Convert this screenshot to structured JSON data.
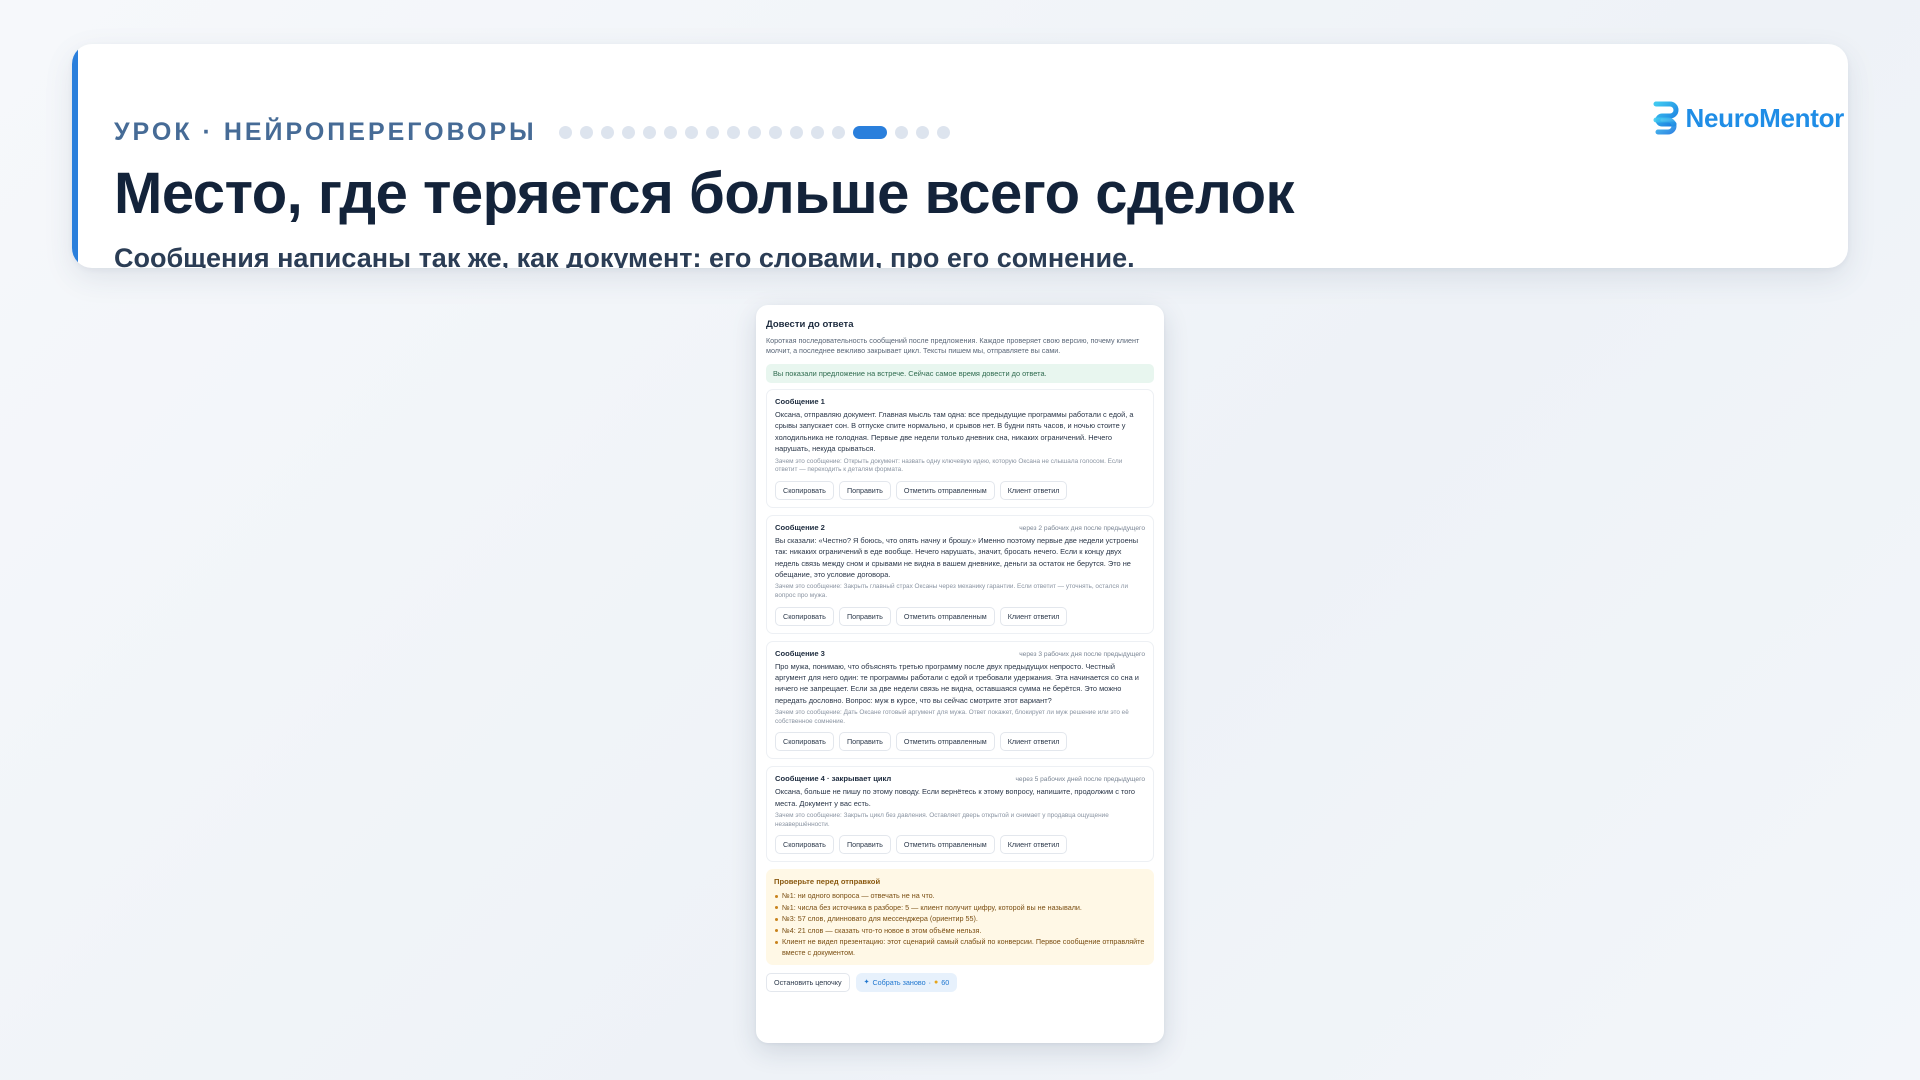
{
  "header": {
    "eyebrow": "УРОК · НЕЙРОПЕРЕГОВОРЫ",
    "progress": {
      "total": 18,
      "current": 15
    },
    "title": "Место, где теряется больше всего сделок",
    "subtitle": "Сообщения написаны так же, как документ: его словами, про его сомнение.",
    "brand": "NeuroMentor",
    "brand_icon": "neuromentor-logo-icon",
    "accent_color": "#2a7fdc"
  },
  "panel": {
    "title": "Довести до ответа",
    "description": "Короткая последовательность сообщений после предложения. Каждое проверяет свою версию, почему клиент молчит, а последнее вежливо закрывает цикл. Тексты пишем мы, отправляете вы сами.",
    "banner": "Вы показали предложение на встрече. Сейчас самое время довести до ответа.",
    "messages": [
      {
        "title": "Сообщение 1",
        "delay": "",
        "body": "Оксана, отправляю документ. Главная мысль там одна: все предыдущие программы работали с едой, а срывы запускает сон. В отпуске спите нормально, и срывов нет. В будни пять часов, и ночью стоите у холодильника не голодная. Первые две недели только дневник сна, никаких ограничений. Нечего нарушать, некуда срываться.",
        "why": "Зачем это сообщение: Открыть документ: назвать одну ключевую идею, которую Оксана не слышала голосом. Если ответит — переходить к деталям формата."
      },
      {
        "title": "Сообщение 2",
        "delay": "через 2 рабочих дня после предыдущего",
        "body": "Вы сказали: «Честно? Я боюсь, что опять начну и брошу.» Именно поэтому первые две недели устроены так: никаких ограничений в еде вообще. Нечего нарушать, значит, бросать нечего. Если к концу двух недель связь между сном и срывами не видна в вашем дневнике, деньги за остаток не берутся. Это не обещание, это условие договора.",
        "why": "Зачем это сообщение: Закрыть главный страх Оксаны через механику гарантии. Если ответит — уточнять, остался ли вопрос про мужа."
      },
      {
        "title": "Сообщение 3",
        "delay": "через 3 рабочих дня после предыдущего",
        "body": "Про мужа, понимаю, что объяснять третью программу после двух предыдущих непросто. Честный аргумент для него один: те программы работали с едой и требовали удержания. Эта начинается со сна и ничего не запрещает. Если за две недели связь не видна, оставшаяся сумма не берётся. Это можно передать дословно. Вопрос: муж в курсе, что вы сейчас смотрите этот вариант?",
        "why": "Зачем это сообщение: Дать Оксане готовый аргумент для мужа. Ответ покажет, блокирует ли муж решение или это её собственное сомнение."
      },
      {
        "title": "Сообщение 4 · закрывает цикл",
        "delay": "через 5 рабочих дней после предыдущего",
        "body": "Оксана, больше не пишу по этому поводу. Если вернётесь к этому вопросу, напишите, продолжим с того места. Документ у вас есть.",
        "why": "Зачем это сообщение: Закрыть цикл без давления. Оставляет дверь открытой и снимает у продавца ощущение незавершённости."
      }
    ],
    "actions": {
      "copy": "Скопировать",
      "edit": "Поправить",
      "mark_sent": "Отметить отправленным",
      "client_replied": "Клиент ответил"
    },
    "checklist": {
      "title": "Проверьте перед отправкой",
      "items": [
        "№1: ни одного вопроса — отвечать не на что.",
        "№1: числа без источника в разборе: 5 — клиент получит цифру, которой вы не называли.",
        "№3: 57 слов, длинновато для мессенджера (ориентир 55).",
        "№4: 21 слов — сказать что-то новое в этом объёме нельзя.",
        "Клиент не видел презентацию: этот сценарий самый слабый по конверсии. Первое сообщение отправляйте вместе с документом."
      ]
    },
    "footer": {
      "stop": "Остановить цепочку",
      "rebuild": "Собрать заново",
      "separator": "·",
      "cost": "60",
      "rebuild_icon": "sparkle-icon",
      "cost_icon": "coin-icon"
    }
  }
}
